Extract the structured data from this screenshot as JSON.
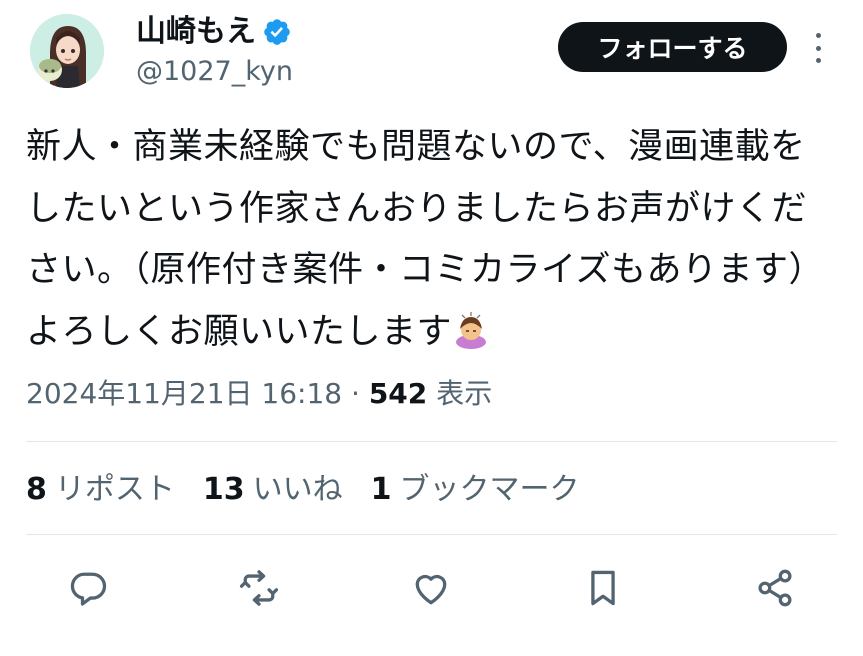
{
  "author": {
    "display_name": "山崎もえ",
    "handle": "@1027_kyn",
    "verified_icon": "verified-badge-icon",
    "avatar_icon": "avatar"
  },
  "follow_button": {
    "label": "フォローする"
  },
  "more_icon": "more-options-icon",
  "tweet": {
    "text": "新人・商業未経験でも問題ないので、漫画連載をしたいという作家さんおりましたらお声がけください。（原作付き案件・コミカライズもあります）よろしくお願いいたします",
    "emoji": "🙇‍♀️"
  },
  "meta": {
    "timestamp": "2024年11月21日 16:18",
    "separator": "·",
    "views_count": "542",
    "views_label": "表示"
  },
  "stats": {
    "reposts_count": "8",
    "reposts_label": "リポスト",
    "likes_count": "13",
    "likes_label": "いいね",
    "bookmarks_count": "1",
    "bookmarks_label": "ブックマーク"
  },
  "colors": {
    "text": "#0f1419",
    "secondary": "#536471",
    "verified": "#1d9bf0",
    "button_bg": "#0f1419",
    "divider": "#e1e6ea"
  },
  "actions": [
    "reply-icon",
    "repost-icon",
    "like-icon",
    "bookmark-icon",
    "share-icon"
  ]
}
